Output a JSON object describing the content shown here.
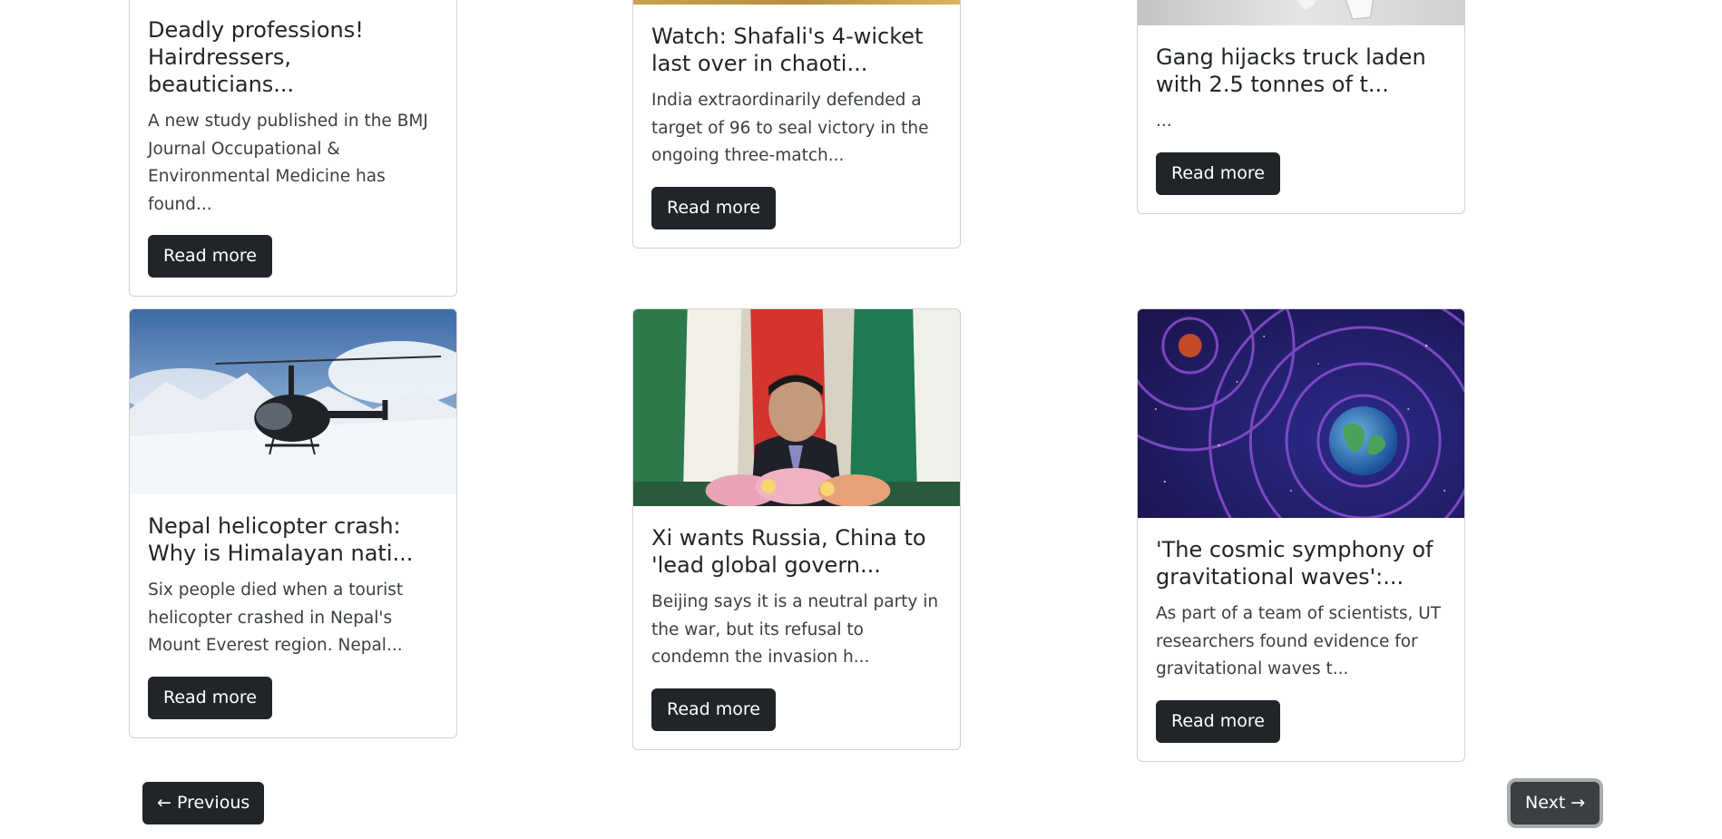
{
  "articles": [
    {
      "title": "Deadly professions! Hairdressers, beauticians...",
      "description": "A new study published in the BMJ Journal Occupational & Environmental Medicine has found...",
      "button": "Read more"
    },
    {
      "title": "Watch: Shafali's 4-wicket last over in chaoti...",
      "description": "India extraordinarily defended a target of 96 to seal victory in the ongoing three-match...",
      "button": "Read more"
    },
    {
      "title": "Gang hijacks truck laden with 2.5 tonnes of t...",
      "description": "...",
      "button": "Read more"
    },
    {
      "title": "Nepal helicopter crash: Why is Himalayan nati...",
      "description": "Six people died when a tourist helicopter crashed in Nepal's Mount Everest region. Nepal...",
      "button": "Read more"
    },
    {
      "title": "Xi wants Russia, China to 'lead global govern...",
      "description": "Beijing says it is a neutral party in the war, but its refusal to condemn the invasion h...",
      "button": "Read more"
    },
    {
      "title": "'The cosmic symphony of gravitational waves':...",
      "description": "As part of a team of scientists, UT researchers found evidence for gravitational waves t...",
      "button": "Read more"
    }
  ],
  "pagination": {
    "previous": "← Previous",
    "next": "Next →"
  },
  "colors": {
    "button_dark": "#212529",
    "card_border": "rgba(0,0,0,0.175)",
    "text": "#212529"
  }
}
